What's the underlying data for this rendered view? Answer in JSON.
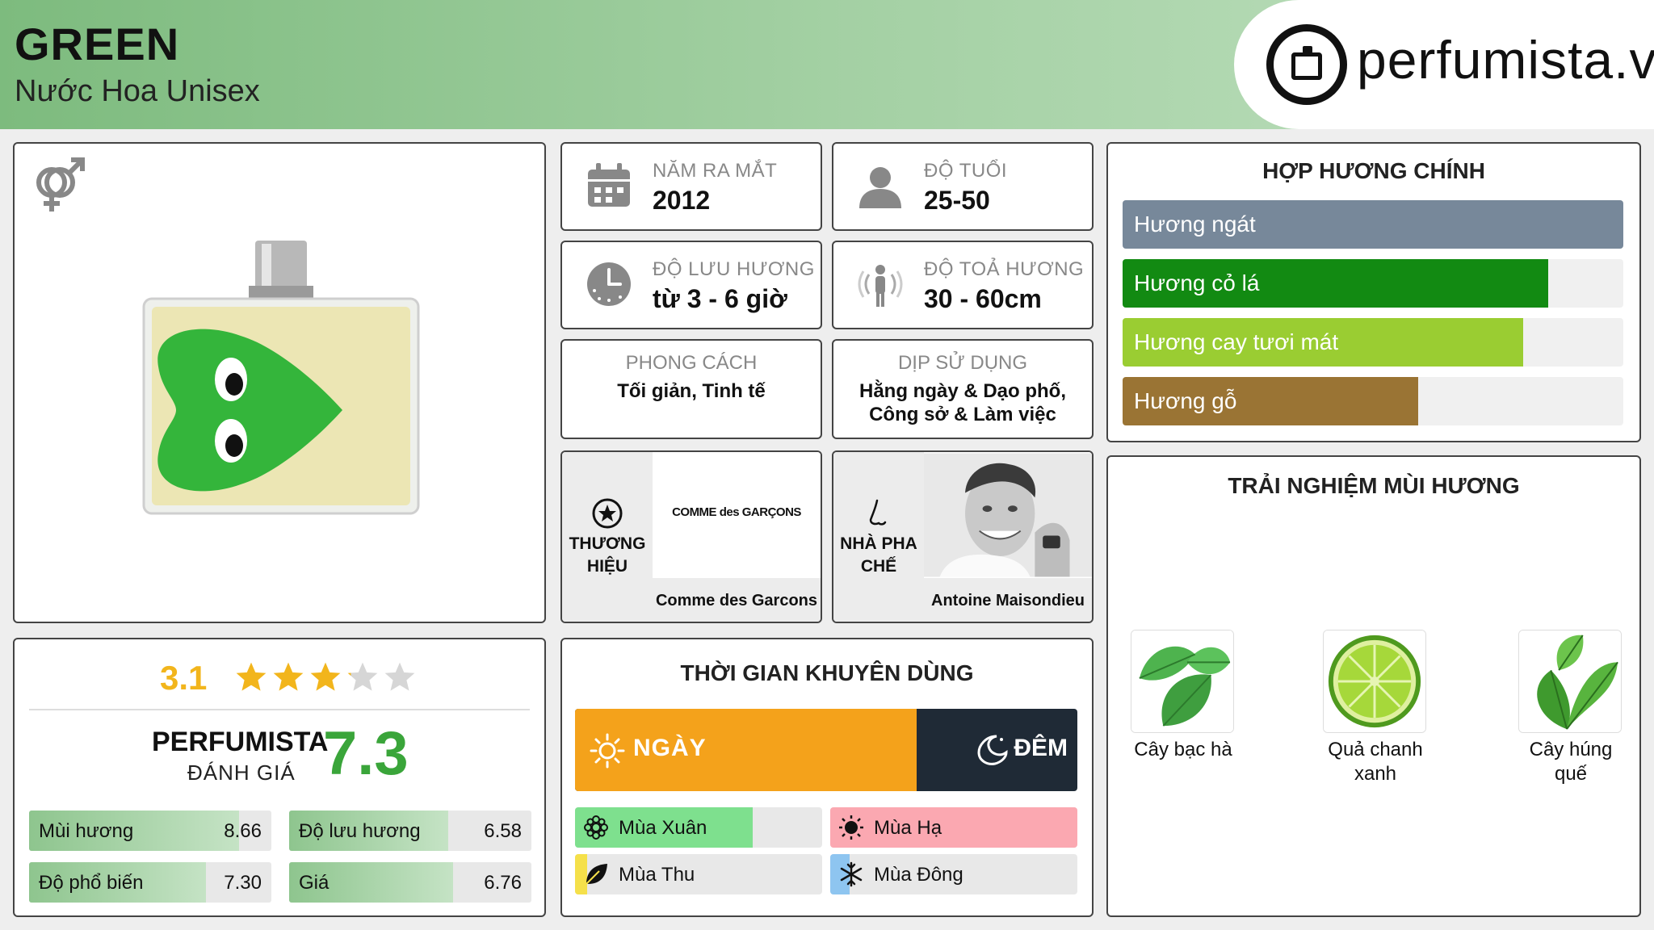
{
  "header": {
    "title": "GREEN",
    "subtitle": "Nước Hoa Unisex",
    "brand_site": "perfumista.vn"
  },
  "info": {
    "launch_year": {
      "label": "NĂM RA MẮT",
      "value": "2012"
    },
    "age": {
      "label": "ĐỘ TUỔI",
      "value": "25-50"
    },
    "longevity": {
      "label": "ĐỘ LƯU HƯƠNG",
      "value": "từ 3 - 6 giờ"
    },
    "sillage": {
      "label": "ĐỘ TOẢ HƯƠNG",
      "value": "30 - 60cm"
    },
    "style": {
      "label": "PHONG CÁCH",
      "value": "Tối giản, Tinh tế"
    },
    "occasion": {
      "label": "DỊP SỬ DỤNG",
      "value": "Hằng ngày & Dạo phố, Công sở & Làm việc"
    },
    "brand": {
      "label_1": "THƯƠNG",
      "label_2": "HIỆU",
      "logo_text": "COMME des GARÇONS",
      "name": "Comme des Garcons"
    },
    "perfumer": {
      "label_1": "NHÀ PHA",
      "label_2": "CHẾ",
      "name": "Antoine Maisondieu"
    }
  },
  "accords": {
    "title": "HỢP HƯƠNG CHÍNH",
    "items": [
      {
        "label": "Hương ngát",
        "value": 1.0,
        "color": "#77889a"
      },
      {
        "label": "Hương cỏ lá",
        "value": 0.85,
        "color": "#128a12"
      },
      {
        "label": "Hương cay tươi mát",
        "value": 0.8,
        "color": "#9acd32"
      },
      {
        "label": "Hương gỗ",
        "value": 0.59,
        "color": "#9a7434"
      }
    ]
  },
  "rating": {
    "user_score": "3.1",
    "user_stars": 3.1,
    "brand_label": "PERFUMISTA",
    "brand_sub": "ĐÁNH GIÁ",
    "brand_score": "7.3",
    "metrics": [
      {
        "label": "Mùi hương",
        "value": "8.66",
        "fill": 0.866
      },
      {
        "label": "Độ lưu hương",
        "value": "6.58",
        "fill": 0.658
      },
      {
        "label": "Độ phổ biến",
        "value": "7.30",
        "fill": 0.73
      },
      {
        "label": "Giá",
        "value": "6.76",
        "fill": 0.676
      }
    ]
  },
  "time": {
    "title": "THỜI GIAN KHUYÊN DÙNG",
    "day_label": "NGÀY",
    "night_label": "ĐÊM",
    "day_fill": 0.68,
    "seasons": [
      {
        "label": "Mùa Xuân",
        "fill": 0.72,
        "color": "#7ee08e"
      },
      {
        "label": "Mùa Hạ",
        "fill": 1.0,
        "color": "#fba8b1"
      },
      {
        "label": "Mùa Thu",
        "fill": 0.05,
        "color": "#f5e04a"
      },
      {
        "label": "Mùa Đông",
        "fill": 0.08,
        "color": "#8ec5f0"
      }
    ]
  },
  "notes": {
    "title": "TRẢI NGHIỆM MÙI HƯƠNG",
    "items": [
      {
        "label_1": "Cây bạc hà",
        "label_2": ""
      },
      {
        "label_1": "Quả chanh",
        "label_2": "xanh"
      },
      {
        "label_1": "Cây húng",
        "label_2": "quế"
      }
    ]
  }
}
